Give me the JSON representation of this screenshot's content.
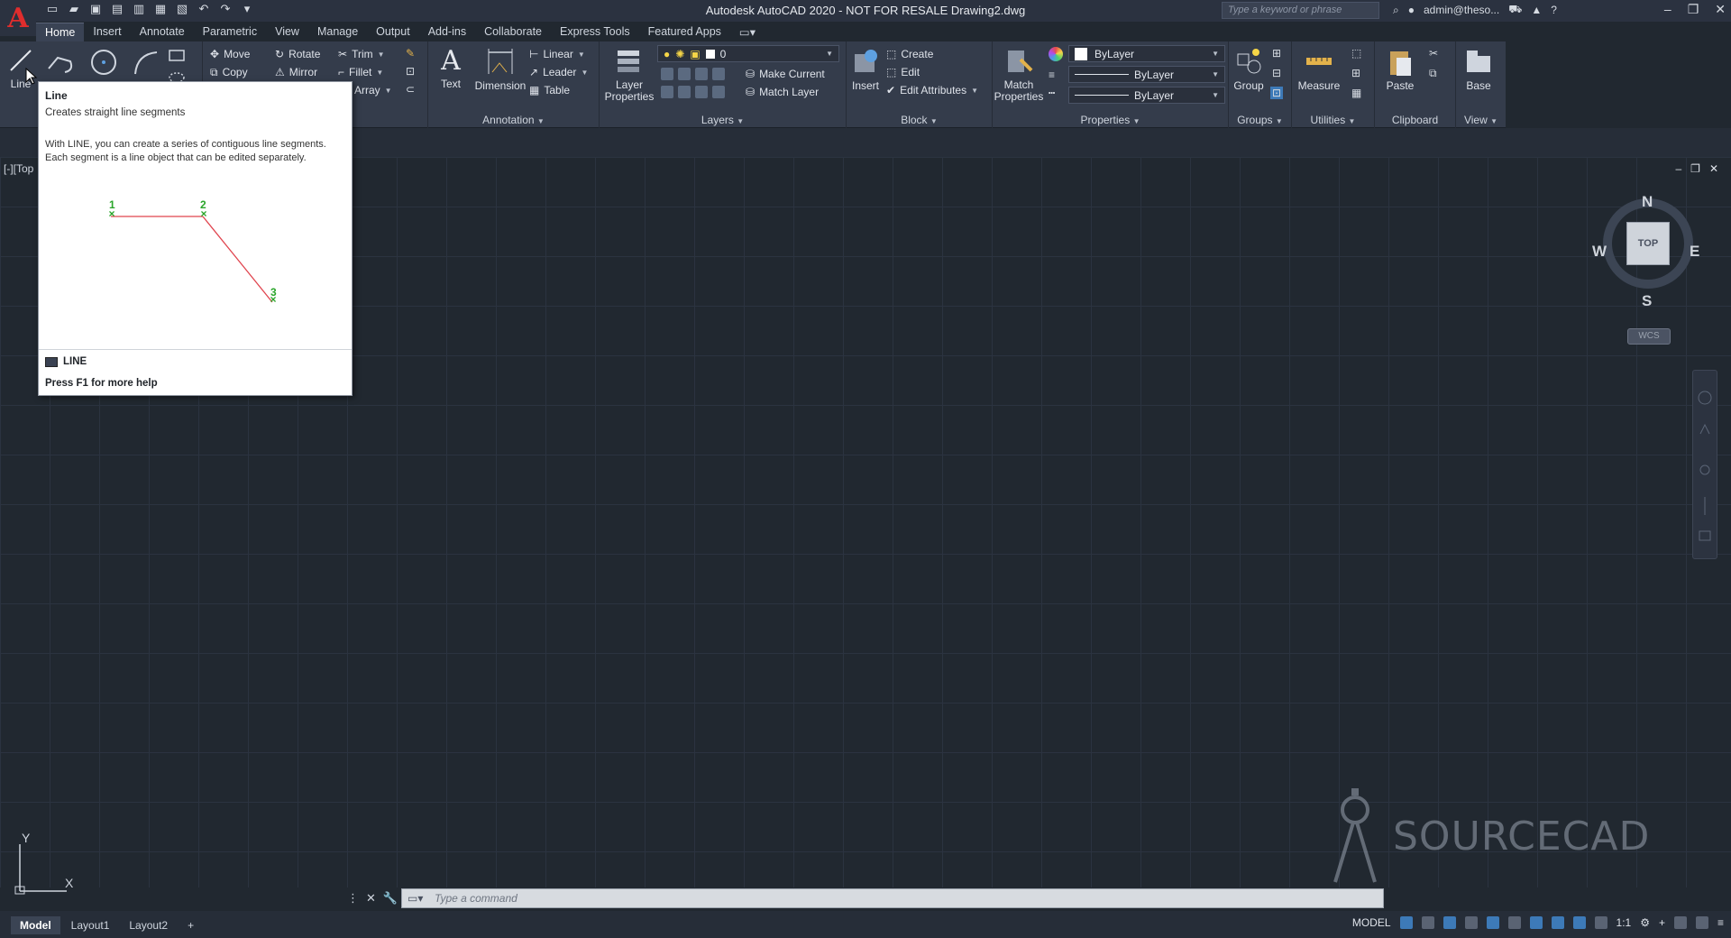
{
  "window": {
    "title": "Autodesk AutoCAD 2020 - NOT FOR RESALE    Drawing2.dwg",
    "search_placeholder": "Type a keyword or phrase",
    "user": "admin@theso...",
    "app_logo": "A"
  },
  "ribbon_tabs": [
    "Home",
    "Insert",
    "Annotate",
    "Parametric",
    "View",
    "Manage",
    "Output",
    "Add-ins",
    "Collaborate",
    "Express Tools",
    "Featured Apps"
  ],
  "ribbon": {
    "draw": {
      "line": "Line"
    },
    "modify": {
      "move": "Move",
      "rotate": "Rotate",
      "trim": "Trim",
      "copy": "Copy",
      "mirror": "Mirror",
      "fillet": "Fillet",
      "array": "Array"
    },
    "annotation": {
      "title": "Annotation",
      "text": "Text",
      "dimension": "Dimension",
      "linear": "Linear",
      "leader": "Leader",
      "table": "Table"
    },
    "layers": {
      "title": "Layers",
      "layer_properties_1": "Layer",
      "layer_properties_2": "Properties",
      "current_layer": "0",
      "make_current": "Make Current",
      "match_layer": "Match Layer"
    },
    "block": {
      "title": "Block",
      "insert": "Insert",
      "create": "Create",
      "edit": "Edit",
      "edit_attributes": "Edit Attributes"
    },
    "properties": {
      "title": "Properties",
      "match_1": "Match",
      "match_2": "Properties",
      "color": "ByLayer",
      "linetype": "ByLayer",
      "lineweight": "ByLayer"
    },
    "groups": {
      "title": "Groups",
      "group": "Group"
    },
    "utilities": {
      "title": "Utilities",
      "measure": "Measure"
    },
    "clipboard": {
      "title": "Clipboard",
      "paste": "Paste"
    },
    "view": {
      "title": "View",
      "base": "Base"
    }
  },
  "viewport": {
    "label": "[-][Top",
    "viewcube": {
      "n": "N",
      "s": "S",
      "e": "E",
      "w": "W",
      "face": "TOP",
      "wcs": "WCS"
    },
    "ucs": {
      "x": "X",
      "y": "Y"
    }
  },
  "tooltip": {
    "title": "Line",
    "description": "Creates straight line segments",
    "body": "With LINE, you can create a series of contiguous line segments. Each segment is a line object that can be edited separately.",
    "points": [
      "1",
      "2",
      "3"
    ],
    "command": "LINE",
    "help": "Press F1 for more help"
  },
  "command_line": {
    "placeholder": "Type  a  command"
  },
  "layout_tabs": [
    "Model",
    "Layout1",
    "Layout2"
  ],
  "status": {
    "model": "MODEL",
    "scale": "1:1"
  },
  "watermark": {
    "text": "SOURCECAD"
  },
  "colors": {
    "background": "#212830",
    "ribbon": "#343c4b",
    "accent_red": "#e02d2d",
    "diagram_line": "#e0434d",
    "point_green": "#2aa52a"
  }
}
